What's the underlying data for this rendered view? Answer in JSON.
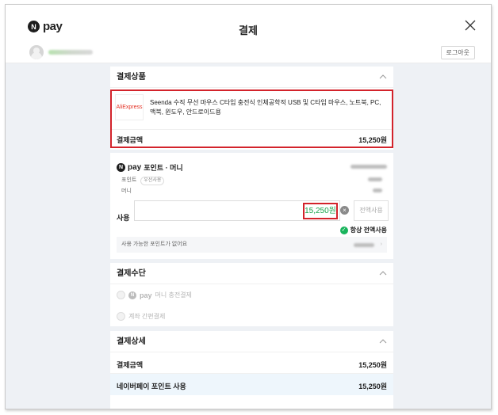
{
  "header": {
    "brand": "pay",
    "brand_mark": "N",
    "title": "결제"
  },
  "user": {
    "logout_label": "로그아웃"
  },
  "product_section": {
    "title": "결제상품",
    "thumbnail_text": "AliExpress",
    "product_name": "Seenda 수직 무선 마우스 C타입 충전식 인체공학적 USB 및 C타입 마우스, 노트북, PC, 맥북, 윈도우, 안드로이드용",
    "amount_label": "결제금액",
    "amount_value": "15,250원"
  },
  "points_section": {
    "title": "포인트 · 머니",
    "point_label": "포인트",
    "point_tag": "우선사용",
    "money_label": "머니",
    "use_label": "사용",
    "use_amount": "15,250원",
    "use_all_label": "전액사용",
    "always_use_label": "항상 전액사용",
    "notice": "사용 가능한 포인트가 없어요"
  },
  "payment_method": {
    "title": "결제수단",
    "options": [
      {
        "label": "머니 충전결제"
      },
      {
        "label": "계좌 간편결제"
      }
    ]
  },
  "payment_detail": {
    "title": "결제상세",
    "rows": [
      {
        "label": "결제금액",
        "value": "15,250원"
      },
      {
        "label": "네이버페이 포인트 사용",
        "value": "15,250원"
      }
    ]
  },
  "colors": {
    "highlight_red": "#d3232b",
    "amount_green": "#16a34a",
    "check_green": "#19b45c",
    "content_bg": "#eef1f5",
    "detail_row_bg": "#eef6fc"
  }
}
